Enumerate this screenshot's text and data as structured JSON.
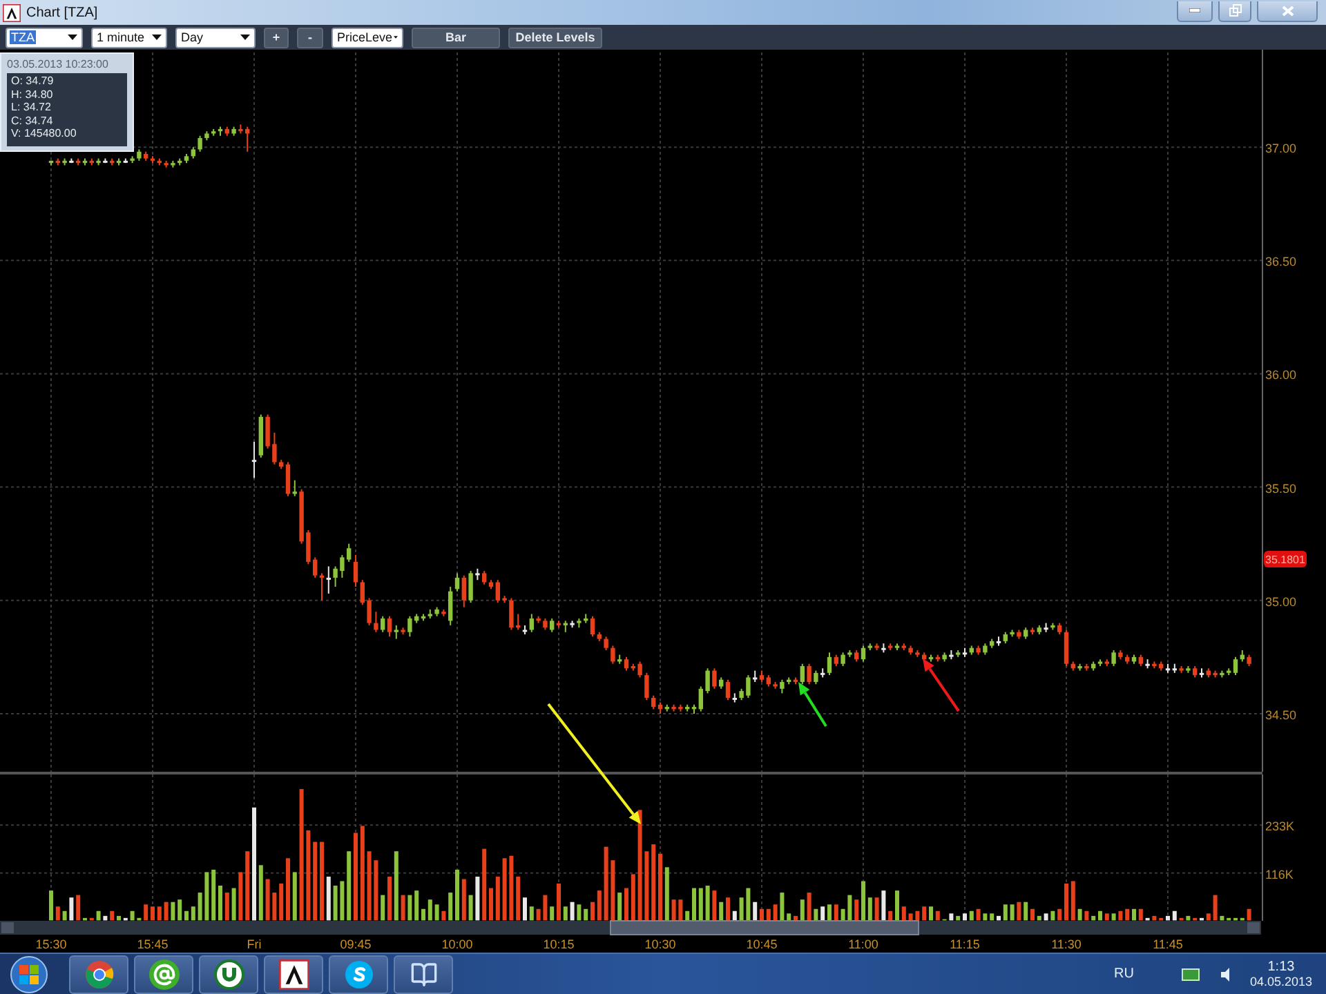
{
  "window": {
    "title": "Chart [TZA]"
  },
  "toolbar": {
    "symbol": {
      "value": "TZA",
      "selected": true
    },
    "interval": {
      "value": "1 minute"
    },
    "range": {
      "value": "Day"
    },
    "zoom_in": "+",
    "zoom_out": "-",
    "study": {
      "value": "PriceLeve"
    },
    "chart_type": "Bar",
    "delete_levels": "Delete Levels"
  },
  "tooltip": {
    "timestamp": "03.05.2013 10:23:00",
    "lines": [
      "O: 34.79",
      "H: 34.80",
      "L: 34.72",
      "C: 34.74",
      "V: 145480.00"
    ]
  },
  "price_chart": {
    "last_price": "35.1801",
    "chart_data": {
      "type": "candlestick",
      "grid": true,
      "ohlc": [
        [
          36.93,
          36.94,
          36.92,
          36.94
        ],
        [
          36.94,
          36.95,
          36.92,
          36.93
        ],
        [
          36.93,
          36.95,
          36.92,
          36.94
        ],
        [
          36.94,
          36.95,
          36.93,
          36.94
        ],
        [
          36.94,
          36.95,
          36.92,
          36.93
        ],
        [
          36.93,
          36.95,
          36.92,
          36.94
        ],
        [
          36.94,
          36.95,
          36.92,
          36.93
        ],
        [
          36.93,
          36.95,
          36.92,
          36.94
        ],
        [
          36.94,
          36.95,
          36.93,
          36.94
        ],
        [
          36.94,
          36.95,
          36.92,
          36.93
        ],
        [
          36.93,
          36.95,
          36.92,
          36.94
        ],
        [
          36.94,
          36.95,
          36.93,
          36.94
        ],
        [
          36.94,
          36.96,
          36.93,
          36.95
        ],
        [
          36.95,
          36.99,
          36.94,
          36.98
        ],
        [
          36.97,
          36.98,
          36.94,
          36.95
        ],
        [
          36.95,
          36.96,
          36.93,
          36.94
        ],
        [
          36.94,
          36.95,
          36.92,
          36.93
        ],
        [
          36.93,
          36.94,
          36.91,
          36.92
        ],
        [
          36.92,
          36.94,
          36.91,
          36.93
        ],
        [
          36.93,
          36.95,
          36.92,
          36.94
        ],
        [
          36.94,
          36.97,
          36.93,
          36.96
        ],
        [
          36.96,
          37.0,
          36.95,
          36.99
        ],
        [
          36.99,
          37.05,
          36.98,
          37.04
        ],
        [
          37.04,
          37.07,
          37.03,
          37.06
        ],
        [
          37.06,
          37.08,
          37.05,
          37.07
        ],
        [
          37.07,
          37.09,
          37.05,
          37.08
        ],
        [
          37.08,
          37.09,
          37.05,
          37.06
        ],
        [
          37.06,
          37.09,
          37.05,
          37.08
        ],
        [
          37.08,
          37.1,
          37.06,
          37.07
        ],
        [
          37.08,
          37.09,
          36.98,
          37.06
        ],
        [
          35.62,
          35.7,
          35.54,
          35.62
        ],
        [
          35.64,
          35.82,
          35.63,
          35.81
        ],
        [
          35.81,
          35.82,
          35.67,
          35.68
        ],
        [
          35.69,
          35.74,
          35.6,
          35.61
        ],
        [
          35.61,
          35.62,
          35.58,
          35.59
        ],
        [
          35.6,
          35.61,
          35.46,
          35.47
        ],
        [
          35.47,
          35.53,
          35.46,
          35.48
        ],
        [
          35.48,
          35.49,
          35.25,
          35.26
        ],
        [
          35.3,
          35.31,
          35.16,
          35.17
        ],
        [
          35.18,
          35.19,
          35.1,
          35.11
        ],
        [
          35.11,
          35.12,
          35.0,
          35.1
        ],
        [
          35.1,
          35.15,
          35.03,
          35.1
        ],
        [
          35.1,
          35.15,
          35.06,
          35.14
        ],
        [
          35.13,
          35.2,
          35.1,
          35.19
        ],
        [
          35.18,
          35.25,
          35.17,
          35.23
        ],
        [
          35.17,
          35.2,
          35.06,
          35.08
        ],
        [
          35.08,
          35.09,
          34.98,
          34.99
        ],
        [
          35.0,
          35.01,
          34.89,
          34.9
        ],
        [
          34.9,
          34.95,
          34.86,
          34.87
        ],
        [
          34.87,
          34.93,
          34.86,
          34.92
        ],
        [
          34.92,
          34.93,
          34.84,
          34.86
        ],
        [
          34.86,
          34.89,
          34.83,
          34.87
        ],
        [
          34.87,
          34.88,
          34.85,
          34.86
        ],
        [
          34.86,
          34.93,
          34.84,
          34.92
        ],
        [
          34.91,
          34.94,
          34.9,
          34.93
        ],
        [
          34.92,
          34.94,
          34.91,
          34.93
        ],
        [
          34.93,
          34.96,
          34.92,
          34.94
        ],
        [
          34.94,
          34.97,
          34.93,
          34.96
        ],
        [
          34.95,
          34.96,
          34.93,
          34.94
        ],
        [
          34.91,
          35.06,
          34.89,
          35.04
        ],
        [
          35.05,
          35.12,
          35.04,
          35.1
        ],
        [
          35.1,
          35.11,
          34.97,
          35.0
        ],
        [
          35.0,
          35.13,
          34.99,
          35.12
        ],
        [
          35.12,
          35.14,
          35.09,
          35.12
        ],
        [
          35.12,
          35.13,
          35.07,
          35.08
        ],
        [
          35.08,
          35.09,
          35.05,
          35.06
        ],
        [
          35.08,
          35.09,
          34.99,
          35.0
        ],
        [
          35.01,
          35.02,
          34.99,
          35.0
        ],
        [
          35.0,
          35.01,
          34.87,
          34.88
        ],
        [
          34.89,
          34.94,
          34.87,
          34.88
        ],
        [
          34.87,
          34.89,
          34.85,
          34.87
        ],
        [
          34.87,
          34.94,
          34.86,
          34.92
        ],
        [
          34.92,
          34.93,
          34.9,
          34.91
        ],
        [
          34.91,
          34.92,
          34.87,
          34.88
        ],
        [
          34.87,
          34.92,
          34.86,
          34.91
        ],
        [
          34.9,
          34.91,
          34.88,
          34.89
        ],
        [
          34.89,
          34.91,
          34.86,
          34.9
        ],
        [
          34.9,
          34.91,
          34.88,
          34.9
        ],
        [
          34.9,
          34.92,
          34.88,
          34.91
        ],
        [
          34.91,
          34.94,
          34.9,
          34.92
        ],
        [
          34.92,
          34.93,
          34.84,
          34.85
        ],
        [
          34.85,
          34.86,
          34.82,
          34.83
        ],
        [
          34.83,
          34.84,
          34.78,
          34.79
        ],
        [
          34.79,
          34.8,
          34.72,
          34.73
        ],
        [
          34.73,
          34.76,
          34.72,
          34.74
        ],
        [
          34.74,
          34.75,
          34.69,
          34.7
        ],
        [
          34.71,
          34.72,
          34.69,
          34.7
        ],
        [
          34.72,
          34.73,
          34.66,
          34.67
        ],
        [
          34.67,
          34.68,
          34.56,
          34.57
        ],
        [
          34.57,
          34.58,
          34.52,
          34.53
        ],
        [
          34.54,
          34.55,
          34.5,
          34.52
        ],
        [
          34.52,
          34.54,
          34.51,
          34.53
        ],
        [
          34.53,
          34.54,
          34.51,
          34.52
        ],
        [
          34.53,
          34.54,
          34.51,
          34.52
        ],
        [
          34.52,
          34.54,
          34.51,
          34.53
        ],
        [
          34.52,
          34.54,
          34.5,
          34.53
        ],
        [
          34.52,
          34.62,
          34.51,
          34.61
        ],
        [
          34.6,
          34.7,
          34.59,
          34.69
        ],
        [
          34.69,
          34.7,
          34.61,
          34.62
        ],
        [
          34.62,
          34.66,
          34.61,
          34.65
        ],
        [
          34.64,
          34.65,
          34.56,
          34.57
        ],
        [
          34.57,
          34.59,
          34.55,
          34.57
        ],
        [
          34.57,
          34.61,
          34.56,
          34.6
        ],
        [
          34.58,
          34.67,
          34.57,
          34.66
        ],
        [
          34.66,
          34.69,
          34.64,
          34.66
        ],
        [
          34.67,
          34.69,
          34.64,
          34.65
        ],
        [
          34.66,
          34.67,
          34.62,
          34.63
        ],
        [
          34.63,
          34.64,
          34.61,
          34.62
        ],
        [
          34.61,
          34.65,
          34.59,
          34.64
        ],
        [
          34.64,
          34.66,
          34.63,
          34.65
        ],
        [
          34.65,
          34.66,
          34.63,
          34.64
        ],
        [
          34.64,
          34.72,
          34.63,
          34.71
        ],
        [
          34.71,
          34.72,
          34.63,
          34.64
        ],
        [
          34.64,
          34.69,
          34.63,
          34.68
        ],
        [
          34.68,
          34.7,
          34.66,
          34.68
        ],
        [
          34.68,
          34.77,
          34.67,
          34.75
        ],
        [
          34.75,
          34.76,
          34.71,
          34.72
        ],
        [
          34.72,
          34.77,
          34.71,
          34.76
        ],
        [
          34.76,
          34.78,
          34.75,
          34.77
        ],
        [
          34.77,
          34.78,
          34.73,
          34.74
        ],
        [
          34.74,
          34.8,
          34.73,
          34.79
        ],
        [
          34.79,
          34.81,
          34.78,
          34.8
        ],
        [
          34.8,
          34.81,
          34.78,
          34.79
        ],
        [
          34.79,
          34.81,
          34.77,
          34.79
        ],
        [
          34.8,
          34.81,
          34.78,
          34.79
        ],
        [
          34.79,
          34.81,
          34.78,
          34.8
        ],
        [
          34.8,
          34.81,
          34.78,
          34.79
        ],
        [
          34.79,
          34.8,
          34.76,
          34.77
        ],
        [
          34.77,
          34.78,
          34.75,
          34.76
        ],
        [
          34.76,
          34.77,
          34.73,
          34.74
        ],
        [
          34.74,
          34.76,
          34.73,
          34.75
        ],
        [
          34.75,
          34.76,
          34.73,
          34.74
        ],
        [
          34.74,
          34.77,
          34.73,
          34.76
        ],
        [
          34.76,
          34.78,
          34.74,
          34.76
        ],
        [
          34.76,
          34.78,
          34.75,
          34.77
        ],
        [
          34.77,
          34.79,
          34.75,
          34.77
        ],
        [
          34.77,
          34.8,
          34.76,
          34.79
        ],
        [
          34.79,
          34.8,
          34.76,
          34.77
        ],
        [
          34.77,
          34.81,
          34.76,
          34.8
        ],
        [
          34.8,
          34.83,
          34.79,
          34.82
        ],
        [
          34.82,
          34.84,
          34.8,
          34.82
        ],
        [
          34.82,
          34.86,
          34.81,
          34.85
        ],
        [
          34.85,
          34.87,
          34.84,
          34.86
        ],
        [
          34.86,
          34.87,
          34.83,
          34.84
        ],
        [
          34.84,
          34.88,
          34.83,
          34.87
        ],
        [
          34.87,
          34.88,
          34.85,
          34.86
        ],
        [
          34.86,
          34.89,
          34.85,
          34.88
        ],
        [
          34.88,
          34.9,
          34.86,
          34.88
        ],
        [
          34.88,
          34.9,
          34.87,
          34.89
        ],
        [
          34.89,
          34.9,
          34.85,
          34.86
        ],
        [
          34.86,
          34.87,
          34.71,
          34.72
        ],
        [
          34.72,
          34.73,
          34.69,
          34.7
        ],
        [
          34.7,
          34.72,
          34.69,
          34.71
        ],
        [
          34.71,
          34.72,
          34.69,
          34.7
        ],
        [
          34.7,
          34.73,
          34.69,
          34.72
        ],
        [
          34.72,
          34.74,
          34.71,
          34.73
        ],
        [
          34.73,
          34.74,
          34.71,
          34.72
        ],
        [
          34.72,
          34.78,
          34.71,
          34.77
        ],
        [
          34.77,
          34.78,
          34.74,
          34.75
        ],
        [
          34.75,
          34.76,
          34.72,
          34.73
        ],
        [
          34.73,
          34.76,
          34.72,
          34.75
        ],
        [
          34.75,
          34.76,
          34.71,
          34.72
        ],
        [
          34.72,
          34.74,
          34.7,
          34.72
        ],
        [
          34.72,
          34.73,
          34.7,
          34.71
        ],
        [
          34.72,
          34.73,
          34.69,
          34.7
        ],
        [
          34.7,
          34.72,
          34.68,
          34.7
        ],
        [
          34.7,
          34.72,
          34.68,
          34.7
        ],
        [
          34.7,
          34.71,
          34.68,
          34.69
        ],
        [
          34.69,
          34.71,
          34.68,
          34.7
        ],
        [
          34.7,
          34.71,
          34.66,
          34.67
        ],
        [
          34.68,
          34.7,
          34.66,
          34.68
        ],
        [
          34.69,
          34.7,
          34.66,
          34.67
        ],
        [
          34.68,
          34.69,
          34.66,
          34.67
        ],
        [
          34.67,
          34.69,
          34.66,
          34.68
        ],
        [
          34.68,
          34.7,
          34.67,
          34.69
        ],
        [
          34.68,
          34.75,
          34.67,
          34.74
        ],
        [
          34.74,
          34.78,
          34.73,
          34.76
        ],
        [
          34.75,
          34.76,
          34.71,
          34.72
        ]
      ],
      "ylim": [
        34.25,
        37.43
      ],
      "yticks": [
        {
          "value": 37,
          "label": "37.00"
        },
        {
          "value": 36.5,
          "label": "36.50"
        },
        {
          "value": 36,
          "label": "36.00"
        },
        {
          "value": 35.5,
          "label": "35.50"
        },
        {
          "value": 35,
          "label": "35.00"
        },
        {
          "value": 34.5,
          "label": "34.50"
        }
      ]
    }
  },
  "volume_chart": {
    "chart_data": {
      "type": "bar",
      "grid": true,
      "categories": [
        "15:30",
        null,
        null,
        null,
        null,
        null,
        null,
        null,
        null,
        null,
        null,
        null,
        null,
        null,
        null,
        "15:45",
        null,
        null,
        null,
        null,
        null,
        null,
        null,
        null,
        null,
        null,
        null,
        null,
        null,
        null,
        "Fri",
        null,
        null,
        null,
        null,
        null,
        null,
        null,
        null,
        null,
        null,
        null,
        null,
        null,
        null,
        "09:45",
        null,
        null,
        null,
        null,
        null,
        null,
        null,
        null,
        null,
        null,
        null,
        null,
        null,
        null,
        "10:00",
        null,
        null,
        null,
        null,
        null,
        null,
        null,
        null,
        null,
        null,
        null,
        null,
        null,
        null,
        "10:15",
        null,
        null,
        null,
        null,
        null,
        null,
        null,
        null,
        null,
        null,
        null,
        null,
        null,
        null,
        "10:30",
        null,
        null,
        null,
        null,
        null,
        null,
        null,
        null,
        null,
        null,
        null,
        null,
        null,
        null,
        "10:45",
        null,
        null,
        null,
        null,
        null,
        null,
        null,
        null,
        null,
        null,
        null,
        null,
        null,
        null,
        "11:00",
        null,
        null,
        null,
        null,
        null,
        null,
        null,
        null,
        null,
        null,
        null,
        null,
        null,
        null,
        "11:15",
        null,
        null,
        null,
        null,
        null,
        null,
        null,
        null,
        null,
        null,
        null,
        null,
        null,
        null,
        "11:30",
        null,
        null,
        null,
        null,
        null,
        null,
        null,
        null,
        null,
        null,
        null,
        null,
        null,
        null,
        "11:45",
        null,
        null,
        null,
        null,
        null,
        null,
        null,
        null,
        null,
        null,
        null,
        null
      ],
      "series": [
        {
          "color": "#8cc43c",
          "values": [
            73,
            null,
            23,
            null,
            null,
            6,
            null,
            23,
            null,
            null,
            11,
            null,
            23,
            6,
            null,
            null,
            null,
            null,
            45,
            51,
            23,
            34,
            68,
            118,
            124,
            85,
            null,
            79,
            null,
            null,
            null,
            135,
            null,
            null,
            null,
            null,
            118,
            null,
            null,
            null,
            null,
            null,
            85,
            96,
            169,
            null,
            null,
            null,
            null,
            62,
            null,
            169,
            null,
            62,
            73,
            28,
            51,
            39,
            null,
            68,
            124,
            null,
            62,
            null,
            null,
            null,
            null,
            null,
            null,
            null,
            null,
            34,
            null,
            null,
            34,
            null,
            34,
            null,
            39,
            28,
            null,
            null,
            null,
            null,
            68,
            null,
            null,
            null,
            null,
            null,
            null,
            130,
            null,
            null,
            23,
            79,
            79,
            85,
            null,
            45,
            null,
            null,
            56,
            79,
            null,
            null,
            null,
            null,
            68,
            17,
            null,
            51,
            null,
            28,
            null,
            39,
            null,
            28,
            62,
            null,
            96,
            56,
            null,
            null,
            null,
            73,
            null,
            null,
            null,
            null,
            34,
            null,
            3,
            null,
            11,
            null,
            23,
            null,
            17,
            17,
            null,
            39,
            39,
            null,
            45,
            null,
            11,
            null,
            23,
            null,
            null,
            null,
            28,
            null,
            11,
            23,
            null,
            17,
            null,
            null,
            28,
            null,
            null,
            null,
            null,
            null,
            null,
            null,
            11,
            null,
            null,
            null,
            null,
            11,
            6,
            6,
            6,
            null
          ]
        },
        {
          "color": "#e8401a",
          "values": [
            null,
            34,
            null,
            null,
            62,
            null,
            6,
            null,
            null,
            23,
            null,
            null,
            null,
            null,
            39,
            34,
            34,
            45,
            null,
            null,
            null,
            null,
            null,
            null,
            null,
            null,
            68,
            null,
            118,
            169,
            null,
            null,
            101,
            68,
            90,
            152,
            null,
            321,
            220,
            192,
            192,
            null,
            null,
            null,
            null,
            214,
            231,
            169,
            147,
            null,
            107,
            null,
            62,
            null,
            null,
            null,
            null,
            null,
            23,
            null,
            null,
            101,
            null,
            null,
            175,
            79,
            107,
            152,
            158,
            107,
            null,
            null,
            28,
            62,
            null,
            90,
            null,
            null,
            null,
            null,
            45,
            73,
            180,
            147,
            null,
            79,
            113,
            270,
            169,
            186,
            163,
            null,
            51,
            51,
            null,
            null,
            null,
            null,
            73,
            null,
            56,
            null,
            null,
            null,
            null,
            28,
            28,
            39,
            null,
            null,
            11,
            null,
            68,
            null,
            null,
            null,
            39,
            null,
            null,
            51,
            null,
            null,
            56,
            null,
            23,
            null,
            34,
            17,
            23,
            34,
            null,
            23,
            null,
            null,
            null,
            null,
            null,
            28,
            null,
            null,
            null,
            null,
            null,
            45,
            null,
            28,
            null,
            null,
            null,
            28,
            90,
            96,
            null,
            23,
            null,
            null,
            17,
            null,
            23,
            28,
            null,
            28,
            null,
            11,
            6,
            null,
            null,
            6,
            null,
            6,
            null,
            17,
            62,
            null,
            null,
            null,
            null,
            28
          ]
        },
        {
          "color": "#e8e8e8",
          "values": [
            null,
            null,
            null,
            56,
            null,
            null,
            null,
            null,
            11,
            null,
            null,
            6,
            null,
            null,
            null,
            null,
            null,
            null,
            null,
            null,
            null,
            null,
            null,
            null,
            null,
            null,
            null,
            null,
            null,
            null,
            276,
            null,
            null,
            null,
            null,
            null,
            null,
            null,
            null,
            null,
            null,
            107,
            null,
            null,
            null,
            null,
            null,
            null,
            null,
            null,
            null,
            null,
            null,
            null,
            null,
            null,
            null,
            null,
            null,
            null,
            null,
            null,
            null,
            107,
            null,
            null,
            null,
            null,
            null,
            null,
            56,
            null,
            null,
            null,
            null,
            null,
            null,
            45,
            null,
            null,
            null,
            null,
            null,
            null,
            null,
            null,
            null,
            null,
            null,
            null,
            null,
            null,
            null,
            null,
            null,
            null,
            null,
            null,
            null,
            null,
            null,
            23,
            null,
            null,
            45,
            null,
            null,
            null,
            null,
            null,
            null,
            null,
            null,
            null,
            34,
            null,
            null,
            null,
            null,
            null,
            null,
            null,
            null,
            73,
            null,
            null,
            null,
            null,
            null,
            null,
            null,
            null,
            null,
            17,
            null,
            17,
            null,
            null,
            null,
            null,
            11,
            null,
            null,
            null,
            null,
            null,
            null,
            17,
            null,
            null,
            null,
            null,
            null,
            null,
            null,
            null,
            null,
            null,
            null,
            null,
            null,
            null,
            6,
            null,
            null,
            11,
            23,
            null,
            null,
            null,
            6,
            null,
            null,
            null,
            null,
            null,
            null,
            null
          ]
        }
      ],
      "ylim": [
        0,
        360
      ],
      "yticks": [
        {
          "value": 233,
          "label": "233K"
        },
        {
          "value": 116,
          "label": "116K"
        }
      ]
    }
  },
  "taskbar": {
    "language": "RU",
    "time": "1:13",
    "date": "04.05.2013"
  }
}
